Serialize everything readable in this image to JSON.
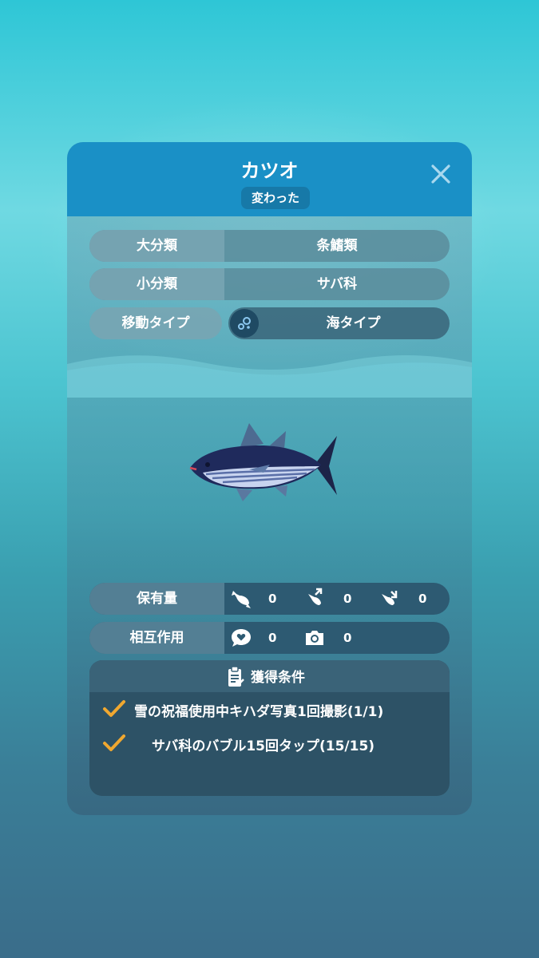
{
  "header": {
    "title": "カツオ",
    "tag": "変わった"
  },
  "classification": [
    {
      "label": "大分類",
      "value": "条鰭類"
    },
    {
      "label": "小分類",
      "value": "サバ科"
    },
    {
      "label": "移動タイプ",
      "value": "海タイプ"
    }
  ],
  "holdings": {
    "label": "保有量",
    "items": [
      {
        "icon": "fish-icon",
        "value": "0"
      },
      {
        "icon": "release-fish-icon",
        "value": "0"
      },
      {
        "icon": "catch-fish-icon",
        "value": "0"
      }
    ]
  },
  "interaction": {
    "label": "相互作用",
    "items": [
      {
        "icon": "heart-bubble-icon",
        "value": "0"
      },
      {
        "icon": "camera-icon",
        "value": "0"
      }
    ]
  },
  "conditions": {
    "title": "獲得条件",
    "items": [
      {
        "text": "雪の祝福使用中キハダ写真1回撮影(1/1)",
        "done": true
      },
      {
        "text": "サバ科のバブル15回タップ(15/15)",
        "done": true
      }
    ]
  },
  "colors": {
    "header": "#1a90c6",
    "check": "#f0a830"
  }
}
